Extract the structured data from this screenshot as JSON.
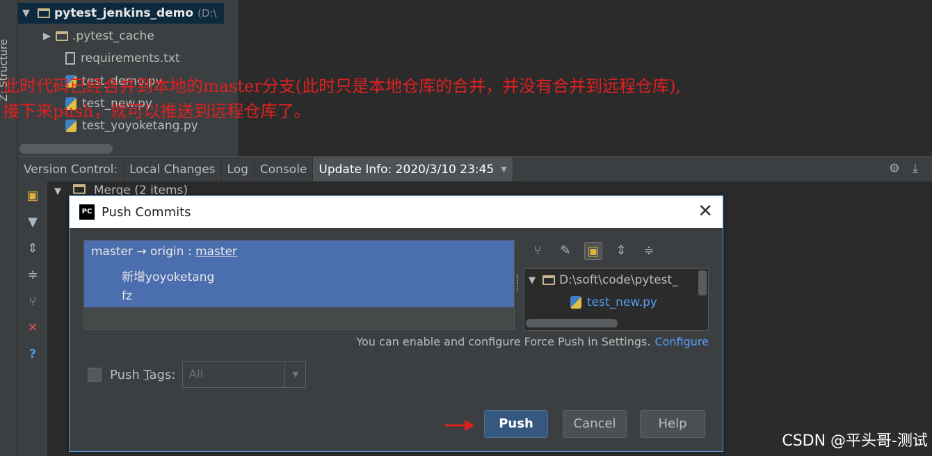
{
  "sidebar": {
    "label": "Z: Structure"
  },
  "project_tree": {
    "items": [
      {
        "name": "pytest_jenkins_demo",
        "suffix": "(D:\\",
        "type": "folder",
        "expanded": true,
        "selected": true
      },
      {
        "name": ".pytest_cache",
        "type": "folder",
        "expanded": false
      },
      {
        "name": "requirements.txt",
        "type": "file"
      },
      {
        "name": "test_demo.py",
        "type": "python"
      },
      {
        "name": "test_new.py",
        "type": "python"
      },
      {
        "name": "test_yoyoketang.py",
        "type": "python"
      }
    ]
  },
  "annotation": {
    "line1": "此时代码已经合并到本地的master分支(此时只是本地仓库的合并，并没有合并到远程仓库),",
    "line2": "接下来push，就可以推送到远程仓库了。",
    "color": "#e02020"
  },
  "tool_window": {
    "tabs": [
      {
        "label": "Version Control:"
      },
      {
        "label": "Local Changes"
      },
      {
        "label": "Log"
      },
      {
        "label": "Console"
      },
      {
        "label": "Update Info: 2020/3/10 23:45",
        "active": true
      }
    ],
    "merge_row": "Merge (2 items)",
    "right_icons": [
      "gear-icon",
      "download-icon"
    ]
  },
  "vc_side_icons": [
    "group-icon",
    "filter-icon",
    "expand-all-icon",
    "collapse-all-icon",
    "fork-icon",
    "close-red-icon",
    "help-icon"
  ],
  "dialog": {
    "title": "Push Commits",
    "logo": "PC",
    "commits": {
      "branch_local": "master",
      "arrow": "→",
      "remote": "origin :",
      "branch_remote": "master",
      "entries": [
        "新增yoyoketang",
        "fz"
      ]
    },
    "files": {
      "root": "D:\\soft\\code\\pytest_",
      "file": "test_new.py"
    },
    "force_hint": "You can enable and configure Force Push in Settings.",
    "configure_link": "Configure",
    "push_tags_label_pre": "Push ",
    "push_tags_label_u": "T",
    "push_tags_label_post": "ags:",
    "push_tags_value": "All",
    "buttons": {
      "push": "Push",
      "cancel": "Cancel",
      "help": "Help"
    },
    "accent": "#4b6eaf"
  },
  "watermark": "CSDN @平头哥-测试"
}
